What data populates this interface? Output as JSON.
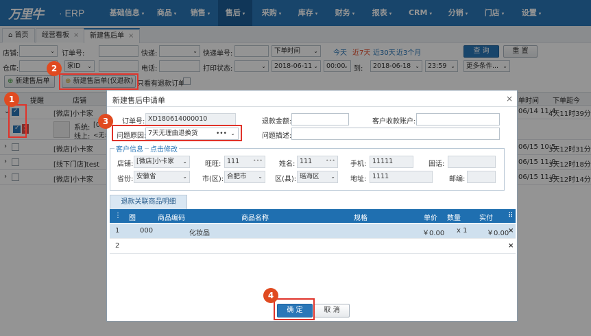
{
  "app": {
    "logo_text": "万里牛",
    "erp": "· ERP"
  },
  "menu": [
    {
      "label": "基础信息",
      "caret": "▾"
    },
    {
      "label": "商品",
      "caret": "▾"
    },
    {
      "label": "销售",
      "caret": "▾"
    },
    {
      "label": "售后",
      "caret": "▾"
    },
    {
      "label": "采购",
      "caret": "▾"
    },
    {
      "label": "库存",
      "caret": "▾"
    },
    {
      "label": "财务",
      "caret": "▾"
    },
    {
      "label": "报表",
      "caret": "▾"
    },
    {
      "label": "CRM",
      "caret": "▾"
    },
    {
      "label": "分销",
      "caret": "▾"
    },
    {
      "label": "门店",
      "caret": "▾"
    },
    {
      "label": "设置",
      "caret": "▾"
    }
  ],
  "tabs": [
    {
      "label": "首页"
    },
    {
      "label": "经营看板",
      "close": "×"
    },
    {
      "label": "新建售后单",
      "close": "×"
    }
  ],
  "filters": {
    "shop": "店铺:",
    "order_no": "订单号:",
    "express": "快递:",
    "express_no": "快递单号:",
    "time_type": "下单时间",
    "today": "今天",
    "last7": "近7天",
    "last30": "近30天",
    "last3m": "近3个月",
    "query": "查 询",
    "reset": "重 置",
    "warehouse": "仓库:",
    "phone": "电话:",
    "print_status": "打印状态:",
    "date_from": "2018-06-11",
    "time_from": "00:00",
    "to": "到:",
    "date_to": "2018-06-18",
    "time_to": "23:59",
    "more": "更多条件...",
    "id_fragment": "家ID"
  },
  "toolbar": {
    "new_aftersale": "新建售后单",
    "new_refund_only": "新建售后单(仅退款)",
    "only_refund_orders": "只看有退款订单"
  },
  "grid": {
    "headers": {
      "remind": "提醒",
      "shop": "店铺",
      "time_suffix": "单时间",
      "order_distance": "下单距今"
    },
    "rows": [
      {
        "shop": "[微店]小卡家",
        "time": "06/14 11:4",
        "distance": "4天11时39分"
      },
      {
        "sys_label": "系统:",
        "sys_value": "[0",
        "online_label": "线上:",
        "online_value": "<无>"
      },
      {
        "shop": "[微店]小卡家",
        "time": "06/15 10:5",
        "distance": "3天12时31分"
      },
      {
        "shop": "[线下门店]test",
        "time": "06/15 11:0",
        "distance": "3天12时18分"
      },
      {
        "shop": "[微店]小卡家",
        "time": "06/15 11:0",
        "distance": "3天12时14分"
      }
    ],
    "row2_badge": "3"
  },
  "annotations": [
    "1",
    "2",
    "3",
    "4"
  ],
  "dialog": {
    "title": "新建售后申请单",
    "close": "×",
    "order_no_label": "订单号:",
    "order_no": "XD180614000010",
    "refund_amount_label": "退款金额:",
    "customer_account_label": "客户收款账户:",
    "reason_label": "问题原因:",
    "reason": "7天无理由退换货",
    "reason_dots": "•••",
    "desc_label": "问题描述:",
    "cust_legend": "客户信息",
    "cust_edit": "点击修改",
    "shop_label": "店铺:",
    "shop": "[微店]小卡家",
    "wangwang_label": "旺旺:",
    "wangwang": "111",
    "name_label": "姓名:",
    "name": "111",
    "mobile_label": "手机:",
    "mobile": "11111",
    "fixed_phone_label": "固话:",
    "province_label": "省份:",
    "province": "安徽省",
    "city_label": "市(区):",
    "city": "合肥市",
    "district_label": "区(县):",
    "district": "瑶海区",
    "address_label": "地址:",
    "address": "1111",
    "zip_label": "邮编:",
    "goods_tab": "退款关联商品明细",
    "table_headers": {
      "menu": "⋮",
      "img": "图",
      "code": "商品编码",
      "name": "商品名称",
      "spec": "规格",
      "price": "单价",
      "qty": "数量",
      "paid": "实付",
      "cols": "⠿"
    },
    "rows": [
      {
        "idx": "1",
        "code": "000",
        "name": "化妆品",
        "price": "￥0.00",
        "qty": "x 1",
        "paid": "￥0.00",
        "del": "×"
      },
      {
        "idx": "2",
        "del": "×"
      }
    ],
    "confirm": "确 定",
    "cancel": "取 消"
  }
}
